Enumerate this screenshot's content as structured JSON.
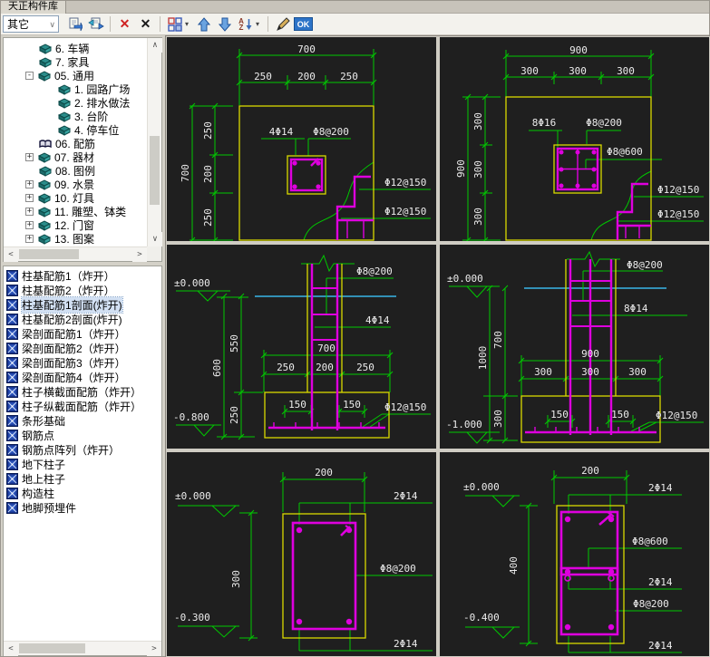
{
  "window": {
    "title": "天正构件库"
  },
  "toolbar": {
    "category": "其它",
    "ok": "OK",
    "sort_a": "A",
    "sort_z": "Z"
  },
  "tree": {
    "items": [
      {
        "label": "6. 车辆"
      },
      {
        "label": "7. 家具"
      },
      {
        "label": "05. 通用",
        "expand": "minus"
      },
      {
        "label": "1. 园路广场"
      },
      {
        "label": "2. 排水做法"
      },
      {
        "label": "3. 台阶"
      },
      {
        "label": "4. 停车位"
      },
      {
        "label": "06. 配筋",
        "icon": "open-book"
      },
      {
        "label": "07. 器材",
        "expand": "plus"
      },
      {
        "label": "08. 图例"
      },
      {
        "label": "09. 水景",
        "expand": "plus"
      },
      {
        "label": "10. 灯具",
        "expand": "plus"
      },
      {
        "label": "11. 雕塑、钵类",
        "expand": "plus"
      },
      {
        "label": "12. 门窗",
        "expand": "plus"
      },
      {
        "label": "13. 图案",
        "expand": "plus"
      }
    ]
  },
  "list": {
    "items": [
      {
        "label": "柱基配筋1（炸开）"
      },
      {
        "label": "柱基配筋2（炸开）"
      },
      {
        "label": "柱基配筋1剖面(炸开)",
        "selected": true
      },
      {
        "label": "柱基配筋2剖面(炸开)"
      },
      {
        "label": "梁剖面配筋1（炸开）"
      },
      {
        "label": "梁剖面配筋2（炸开）"
      },
      {
        "label": "梁剖面配筋3（炸开）"
      },
      {
        "label": "梁剖面配筋4（炸开）"
      },
      {
        "label": "柱子横截面配筋（炸开）"
      },
      {
        "label": "柱子纵截面配筋（炸开）"
      },
      {
        "label": "条形基础"
      },
      {
        "label": "钢筋点"
      },
      {
        "label": "钢筋点阵列（炸开）"
      },
      {
        "label": "地下柱子"
      },
      {
        "label": "地上柱子"
      },
      {
        "label": "构造柱"
      },
      {
        "label": "地脚预埋件"
      }
    ]
  },
  "previews": {
    "plan1": {
      "top_total": "700",
      "top_segs": [
        "250",
        "200",
        "250"
      ],
      "left_total": "700",
      "left_segs": [
        "250",
        "200",
        "250"
      ],
      "bars": "4Φ14",
      "ties": "Φ8@200",
      "mesh1": "Φ12@150",
      "mesh2": "Φ12@150"
    },
    "plan2": {
      "top_total": "900",
      "top_segs": [
        "300",
        "300",
        "300"
      ],
      "left_total": "900",
      "left_segs": [
        "300",
        "300",
        "300"
      ],
      "bars": "8Φ16",
      "ties": "Φ8@200",
      "ties2": "Φ8@600",
      "mesh1": "Φ12@150",
      "mesh2": "Φ12@150"
    },
    "section1": {
      "level_top": "±0.000",
      "level_bottom": "-0.800",
      "v_total": "600",
      "v_segs": [
        "550",
        "250"
      ],
      "h_total": "700",
      "h_segs": [
        "250",
        "200",
        "250"
      ],
      "insets": [
        "150",
        "150"
      ],
      "ties": "Φ8@200",
      "bars": "4Φ14",
      "mesh": "Φ12@150"
    },
    "section2": {
      "level_top": "±0.000",
      "level_bottom": "-1.000",
      "v_total": "1000",
      "v_segs": [
        "700",
        "300"
      ],
      "h_total": "900",
      "h_segs": [
        "300",
        "300",
        "300"
      ],
      "insets": [
        "150",
        "150"
      ],
      "ties": "Φ8@200",
      "bars": "8Φ14",
      "mesh": "Φ12@150"
    },
    "column1": {
      "top_dim": "200",
      "level_top": "±0.000",
      "level_bottom": "-0.300",
      "v_dim": "300",
      "label_top": "2Φ14",
      "label_mid": "Φ8@200",
      "label_bottom": "2Φ14"
    },
    "column2": {
      "top_dim": "200",
      "level_top": "±0.000",
      "level_bottom": "-0.400",
      "v_dim": "400",
      "labels": [
        "2Φ14",
        "Φ8@600",
        "2Φ14",
        "Φ8@200",
        "2Φ14"
      ]
    }
  },
  "colors": {
    "dim_green": "#00c800",
    "rebar_magenta": "#de00de",
    "outline_yellow": "#d9d900",
    "ground_cyan": "#38b6e8",
    "canvas_bg": "#1f1f1f"
  }
}
